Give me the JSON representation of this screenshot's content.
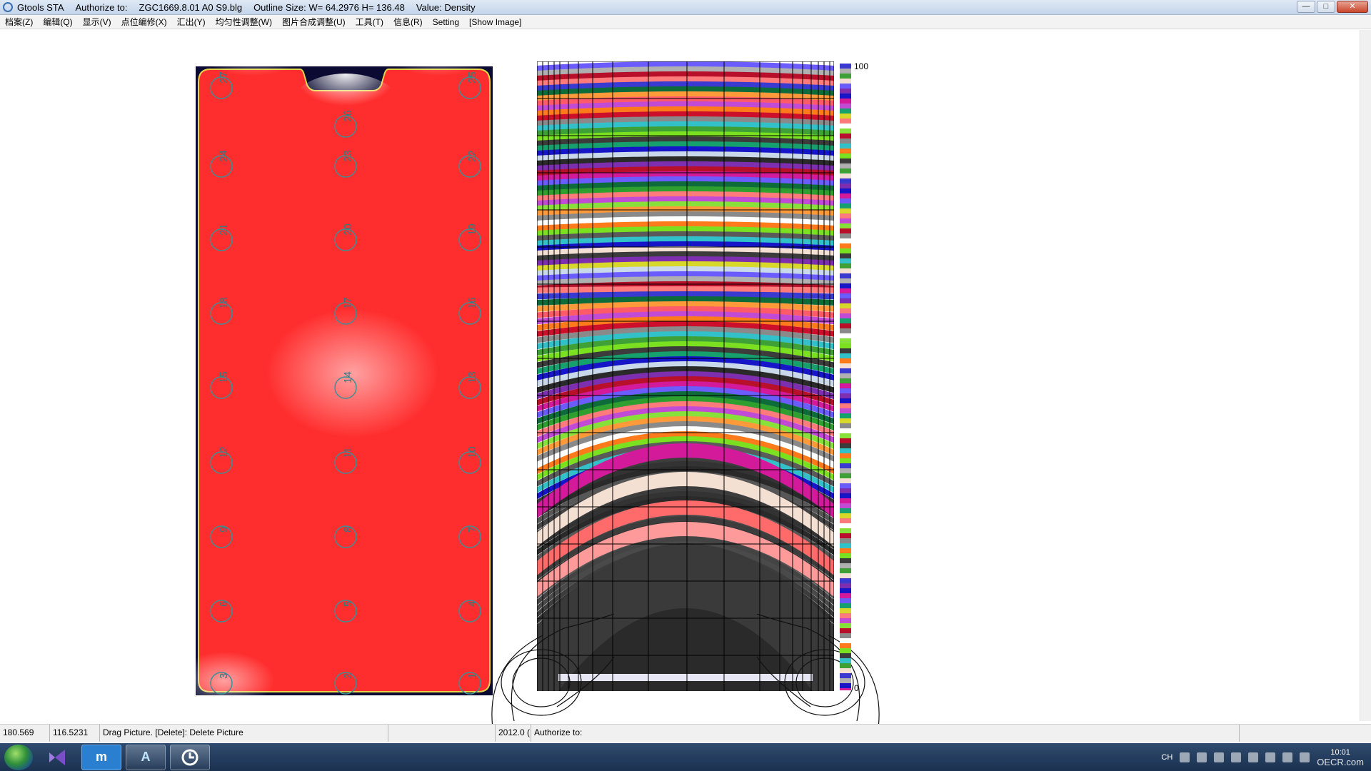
{
  "window": {
    "app_name": "Gtools STA",
    "authorize_label": "Authorize to:",
    "file_name": "ZGC1669.8.01 A0 S9.blg",
    "outline_size": "Outline Size: W= 64.2976  H= 136.48",
    "value": "Value: Density",
    "buttons": {
      "minimize": "—",
      "maximize": "□",
      "close": "✕"
    }
  },
  "menu": [
    "档案(Z)",
    "编辑(Q)",
    "显示(V)",
    "点位编修(X)",
    "汇出(Y)",
    "均匀性调整(W)",
    "图片合成调整(U)",
    "工具(T)",
    "信息(R)",
    "Setting",
    "[Show Image]"
  ],
  "left_picture": {
    "background_color": "#ff2e2e",
    "highlight_color": "#ffffff",
    "point_numbers": [
      "27",
      "26",
      "25",
      "24",
      "23",
      "22",
      "21",
      "20",
      "19",
      "18",
      "17",
      "16",
      "15",
      "14",
      "13",
      "12",
      "11",
      "10",
      "9",
      "8",
      "7",
      "6",
      "5",
      "4",
      "3",
      "2",
      "1"
    ]
  },
  "legend": {
    "max": "100",
    "min": "0"
  },
  "status": {
    "x": "180.569",
    "y": "116.5231",
    "hint": "Drag Picture. [Delete]: Delete Picture",
    "empty": "",
    "value": "2012.0 (",
    "authorize": "Authorize to:"
  },
  "taskbar": {
    "apps": [
      "visual-studio-icon",
      "maxthon-icon",
      "autocad-icon",
      "gtools-icon"
    ],
    "tray_lang": "CH",
    "clock_time": "10:01",
    "watermark": "OECR.com"
  }
}
